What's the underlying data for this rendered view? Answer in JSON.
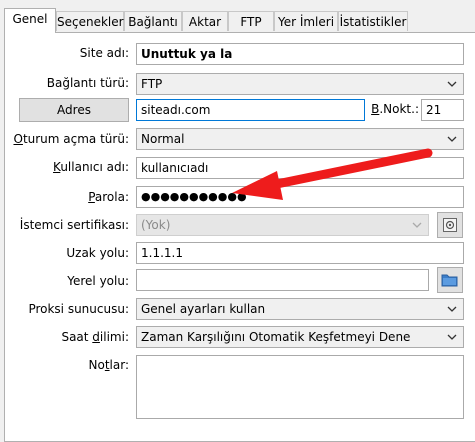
{
  "tabs": [
    "Genel",
    "Seçenekler",
    "Bağlantı",
    "Aktar",
    "FTP",
    "Yer İmleri",
    "İstatistikler"
  ],
  "labels": {
    "site_name": "Site adı:",
    "connection_type": "Bağlantı türü:",
    "address_button": "Adres",
    "port": "B.Nokt.:",
    "logon_type": "Oturum açma türü:",
    "username": "Kullanıcı adı:",
    "password": "Parola:",
    "client_cert": "İstemci sertifikası:",
    "remote_dir": "Uzak yolu:",
    "local_dir": "Yerel yolu:",
    "proxy": "Proksi sunucusu:",
    "timezone": "Saat dilimi:",
    "notes": "Notlar:"
  },
  "values": {
    "site_name": "Unuttuk ya la",
    "connection_type": "FTP",
    "address": "siteadı.com",
    "port": "21",
    "logon_type": "Normal",
    "username": "kullanıcıadı",
    "password": "●●●●●●●●●●●",
    "client_cert": "(Yok)",
    "remote_dir": "1.1.1.1",
    "local_dir": "",
    "proxy": "Genel ayarları kullan",
    "timezone": "Zaman Karşılığını Otomatik Keşfetmeyi Dene",
    "notes": ""
  },
  "colors": {
    "annotation_arrow": "#ee1c1c",
    "focus_border": "#0078d7",
    "folder_icon": "#3a7dc9"
  }
}
